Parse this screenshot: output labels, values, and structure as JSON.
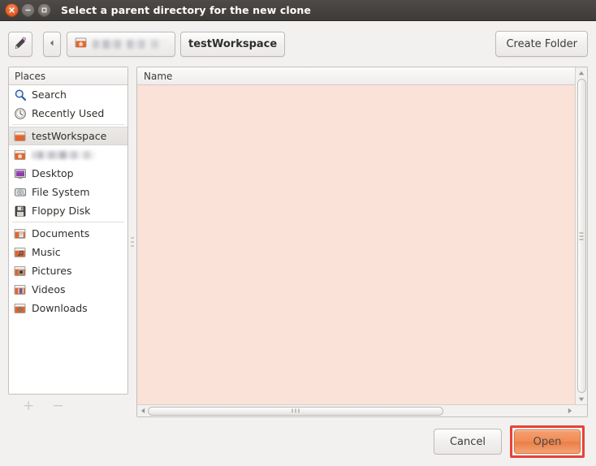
{
  "window": {
    "title": "Select a parent directory for the new clone",
    "controls": [
      {
        "name": "close",
        "icon": "close-icon"
      },
      {
        "name": "minimize",
        "icon": "minimize-icon"
      },
      {
        "name": "maximize",
        "icon": "maximize-icon"
      }
    ]
  },
  "toolbar": {
    "type_location_icon": "pencil-icon",
    "back_icon": "chevron-left-icon",
    "breadcrumbs": [
      {
        "label": "",
        "blurred": true,
        "icon": "home-folder-icon"
      },
      {
        "label": "testWorkspace",
        "blurred": false,
        "current": true
      }
    ],
    "create_folder_label": "Create Folder"
  },
  "sidebar": {
    "header": "Places",
    "items": [
      {
        "label": "Search",
        "icon": "search-icon",
        "selected": false
      },
      {
        "label": "Recently Used",
        "icon": "recent-clock-icon",
        "selected": false
      },
      {
        "label": "testWorkspace",
        "icon": "folder-icon",
        "selected": true
      },
      {
        "label": "",
        "icon": "home-folder-icon",
        "selected": false,
        "blurred": true
      },
      {
        "label": "Desktop",
        "icon": "desktop-icon",
        "selected": false
      },
      {
        "label": "File System",
        "icon": "harddisk-icon",
        "selected": false
      },
      {
        "label": "Floppy Disk",
        "icon": "floppy-icon",
        "selected": false
      },
      {
        "label": "Documents",
        "icon": "documents-folder-icon",
        "selected": false
      },
      {
        "label": "Music",
        "icon": "music-folder-icon",
        "selected": false
      },
      {
        "label": "Pictures",
        "icon": "pictures-folder-icon",
        "selected": false
      },
      {
        "label": "Videos",
        "icon": "videos-folder-icon",
        "selected": false
      },
      {
        "label": "Downloads",
        "icon": "downloads-folder-icon",
        "selected": false
      }
    ],
    "add_label": "+",
    "remove_label": "−"
  },
  "filelist": {
    "columns": [
      "Name"
    ],
    "rows": [],
    "empty": true
  },
  "actions": {
    "cancel_label": "Cancel",
    "open_label": "Open",
    "open_highlighted": true
  },
  "colors": {
    "titlebar": "#3f3b38",
    "close_button": "#df5a22",
    "accent_orange": "#f08c56",
    "highlight_red": "#e8423a",
    "file_area": "#fae2d8",
    "window_bg": "#f2f1f0"
  }
}
